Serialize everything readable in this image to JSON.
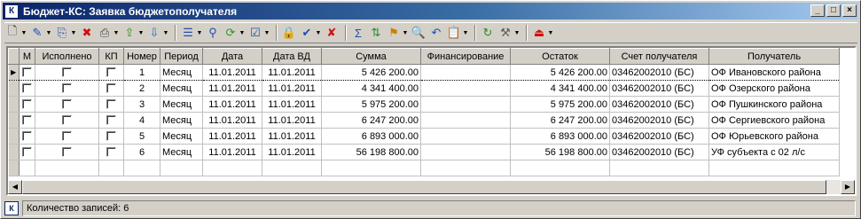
{
  "window": {
    "title": "Бюджет-КС: Заявка бюджетополучателя",
    "app_icon_glyph": "К",
    "minimize": "_",
    "maximize": "□",
    "close": "×"
  },
  "toolbar": {
    "items": [
      {
        "icon": "new-document-icon",
        "glyph": "🗋",
        "color": "#333333",
        "drop": true
      },
      {
        "icon": "edit-icon",
        "glyph": "✎",
        "color": "#1f4fb0",
        "drop": true
      },
      {
        "icon": "copy-icon",
        "glyph": "⎘",
        "color": "#1f4fb0",
        "drop": true
      },
      {
        "icon": "delete-icon",
        "glyph": "✖",
        "color": "#d01010",
        "drop": false
      },
      {
        "icon": "print-icon",
        "glyph": "⎙",
        "color": "#404040",
        "drop": true
      },
      {
        "icon": "export-icon",
        "glyph": "⇪",
        "color": "#3a8a2a",
        "drop": true
      },
      {
        "icon": "import-icon",
        "glyph": "⇩",
        "color": "#2a6ab0",
        "drop": true
      },
      {
        "sep": true
      },
      {
        "icon": "document-list-icon",
        "glyph": "☰",
        "color": "#1f4fb0",
        "drop": true
      },
      {
        "icon": "link-icon",
        "glyph": "⚲",
        "color": "#1f4fb0",
        "drop": false
      },
      {
        "icon": "refresh-green-icon",
        "glyph": "⟳",
        "color": "#2a9a2a",
        "drop": true
      },
      {
        "icon": "checklist-icon",
        "glyph": "☑",
        "color": "#1f4fb0",
        "drop": true
      },
      {
        "sep": true
      },
      {
        "icon": "lock-icon",
        "glyph": "🔒",
        "color": "#b08000",
        "drop": false
      },
      {
        "icon": "approve-check-icon",
        "glyph": "✔",
        "color": "#1f4fb0",
        "drop": true
      },
      {
        "icon": "reject-check-icon",
        "glyph": "✘",
        "color": "#d01010",
        "drop": false
      },
      {
        "sep": true
      },
      {
        "icon": "sum-icon",
        "glyph": "Σ",
        "color": "#1f4fb0",
        "drop": false
      },
      {
        "icon": "sort-icon",
        "glyph": "⇅",
        "color": "#2a8a2a",
        "drop": false
      },
      {
        "icon": "filter-icon",
        "glyph": "⚑",
        "color": "#d08000",
        "drop": true
      },
      {
        "icon": "find-icon",
        "glyph": "🔍",
        "color": "#404040",
        "drop": false
      },
      {
        "icon": "undo-icon",
        "glyph": "↶",
        "color": "#1f4fb0",
        "drop": false
      },
      {
        "icon": "reports-icon",
        "glyph": "📋",
        "color": "#b08000",
        "drop": true
      },
      {
        "sep": true
      },
      {
        "icon": "reload-icon",
        "glyph": "↻",
        "color": "#2a8a2a",
        "drop": false
      },
      {
        "icon": "tools-icon",
        "glyph": "⚒",
        "color": "#606060",
        "drop": true
      },
      {
        "sep": true
      },
      {
        "icon": "exit-icon",
        "glyph": "⏏",
        "color": "#d01010",
        "drop": true
      }
    ]
  },
  "grid": {
    "columns": [
      "",
      "М",
      "Исполнено",
      "КП",
      "Номер",
      "Период",
      "Дата",
      "Дата ВД",
      "Сумма",
      "Финансирование",
      "Остаток",
      "Счет получателя",
      "Получатель"
    ],
    "rows": [
      {
        "num": "1",
        "period": "Месяц",
        "date": "11.01.2011",
        "date_vd": "11.01.2011",
        "sum": "5 426 200.00",
        "fin": "",
        "rest": "5 426 200.00",
        "account": "03462002010 (БС)",
        "recipient": "ОФ Ивановского района",
        "selected": true
      },
      {
        "num": "2",
        "period": "Месяц",
        "date": "11.01.2011",
        "date_vd": "11.01.2011",
        "sum": "4 341 400.00",
        "fin": "",
        "rest": "4 341 400.00",
        "account": "03462002010 (БС)",
        "recipient": "ОФ Озерского района",
        "selected": false
      },
      {
        "num": "3",
        "period": "Месяц",
        "date": "11.01.2011",
        "date_vd": "11.01.2011",
        "sum": "5 975 200.00",
        "fin": "",
        "rest": "5 975 200.00",
        "account": "03462002010 (БС)",
        "recipient": "ОФ Пушкинского района",
        "selected": false
      },
      {
        "num": "4",
        "period": "Месяц",
        "date": "11.01.2011",
        "date_vd": "11.01.2011",
        "sum": "6 247 200.00",
        "fin": "",
        "rest": "6 247 200.00",
        "account": "03462002010 (БС)",
        "recipient": "ОФ Сергиевского района",
        "selected": false
      },
      {
        "num": "5",
        "period": "Месяц",
        "date": "11.01.2011",
        "date_vd": "11.01.2011",
        "sum": "6 893 000.00",
        "fin": "",
        "rest": "6 893 000.00",
        "account": "03462002010 (БС)",
        "recipient": "ОФ Юрьевского района",
        "selected": false
      },
      {
        "num": "6",
        "period": "Месяц",
        "date": "11.01.2011",
        "date_vd": "11.01.2011",
        "sum": "56 198 800.00",
        "fin": "",
        "rest": "56 198 800.00",
        "account": "03462002010 (БС)",
        "recipient": "УФ субъекта с 02 л/с",
        "selected": false
      }
    ],
    "empty_rows": 1,
    "row_indicator": "▶",
    "scroll_left": "◀",
    "scroll_right": "▶"
  },
  "status": {
    "icon_glyph": "К",
    "text": "Количество записей: 6"
  }
}
